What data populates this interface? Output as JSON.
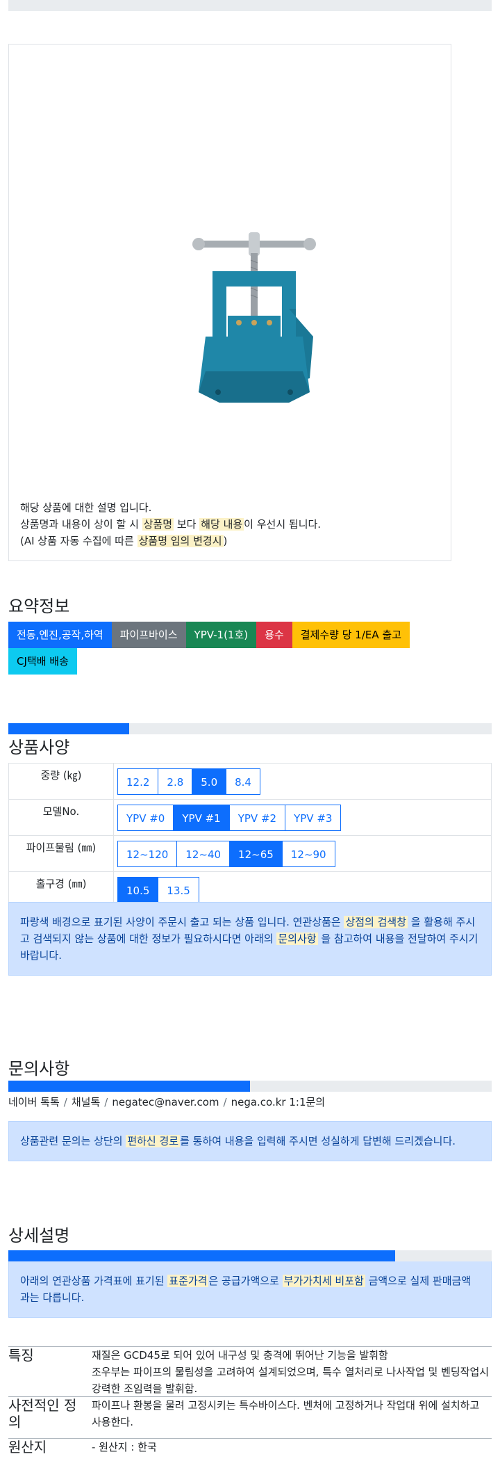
{
  "product_description": {
    "line1": "해당 상품에 대한 설명 입니다.",
    "line2_a": "상품명과 내용이 상이 할 시 ",
    "line2_mark1": "상품명",
    "line2_b": " 보다 ",
    "line2_mark2": "해당 내용",
    "line2_c": "이 우선시 됩니다.",
    "line3_a": "(AI 상품 자동 수집에 따른 ",
    "line3_mark": "상품명 임의 변경시",
    "line3_b": ")"
  },
  "summary": {
    "heading": "요약정보",
    "badges": [
      {
        "label": "전동,엔진,공작,하역",
        "color": "#0d6efd",
        "text": "#ffffff"
      },
      {
        "label": "파이프바이스",
        "color": "#6c757d",
        "text": "#ffffff"
      },
      {
        "label": "YPV-1(1호)",
        "color": "#198754",
        "text": "#ffffff"
      },
      {
        "label": "용수",
        "color": "#dc3545",
        "text": "#ffffff"
      },
      {
        "label": "결제수량 당 1/EA 출고",
        "color": "#ffc107",
        "text": "#000000"
      },
      {
        "label": "CJ택배 배송",
        "color": "#0dcaf0",
        "text": "#000000"
      }
    ]
  },
  "spec": {
    "heading": "상품사양",
    "progress_fraction": 0.25,
    "rows": [
      {
        "label": "중량 (㎏)",
        "options": [
          "12.2",
          "2.8",
          "5.0",
          "8.4"
        ],
        "selected": 2
      },
      {
        "label": "모델No.",
        "options": [
          "YPV #0",
          "YPV #1",
          "YPV #2",
          "YPV #3"
        ],
        "selected": 1
      },
      {
        "label": "파이프물림 (㎜)",
        "options": [
          "12~120",
          "12~40",
          "12~65",
          "12~90"
        ],
        "selected": 2
      },
      {
        "label": "홀구경 (㎜)",
        "options": [
          "10.5",
          "13.5"
        ],
        "selected": 0
      }
    ],
    "notice_a": "파랑색 배경으로 표기된 사양이 주문시 출고 되는 상품 입니다. 연관상품은 ",
    "notice_mark1": "상점의 검색창",
    "notice_b": " 을 활용해 주시고 검색되지 않는 상품에 대한 정보가 필요하시다면 아래의 ",
    "notice_mark2": "문의사항",
    "notice_c": " 을 참고하여 내용을 전달하여 주시기 바랍니다."
  },
  "inquiry": {
    "heading": "문의사항",
    "progress_fraction": 0.5,
    "channels": [
      "네이버 톡톡",
      "채널톡",
      "negatec@naver.com",
      "nega.co.kr 1:1문의"
    ],
    "separator": "/",
    "notice_a": "상품관련 문의는 상단의 ",
    "notice_mark": "편하신 경로",
    "notice_b": "를 통하여 내용을 입력해 주시면 성실하게 답변해 드리겠습니다."
  },
  "detail": {
    "heading": "상세설명",
    "progress_fraction": 0.8,
    "notice_a": "아래의 연관상품 가격표에 표기된 ",
    "notice_mark1": "표준가격",
    "notice_b": "은 공급가액으로 ",
    "notice_mark2": "부가가치세 비포함",
    "notice_c": " 금액으로 실제 판매금액과는 다릅니다.",
    "features": [
      {
        "key": "특징",
        "value": "재질은 GCD45로 되어 있어 내구성 및 충격에 뛰어난 기능을 발휘함\n조우부는 파이프의 물림성을 고려하여 설계되었으며, 특수 열처리로 나사작업 및 벤딩작업시 강력한 조임력을 발휘함."
      },
      {
        "key": "사전적인 정의",
        "value": "파이프나 환봉을 물려 고정시키는 특수바이스다. 벤처에 고정하거나 작업대 위에 설치하고 사용한다."
      },
      {
        "key": "원산지",
        "value": "- 원산지 : 한국"
      }
    ]
  },
  "colors": {
    "primary": "#0d6efd",
    "mark_bg": "#fcf2c7",
    "alert_bg": "#cfe2ff",
    "alert_text": "#084298"
  }
}
